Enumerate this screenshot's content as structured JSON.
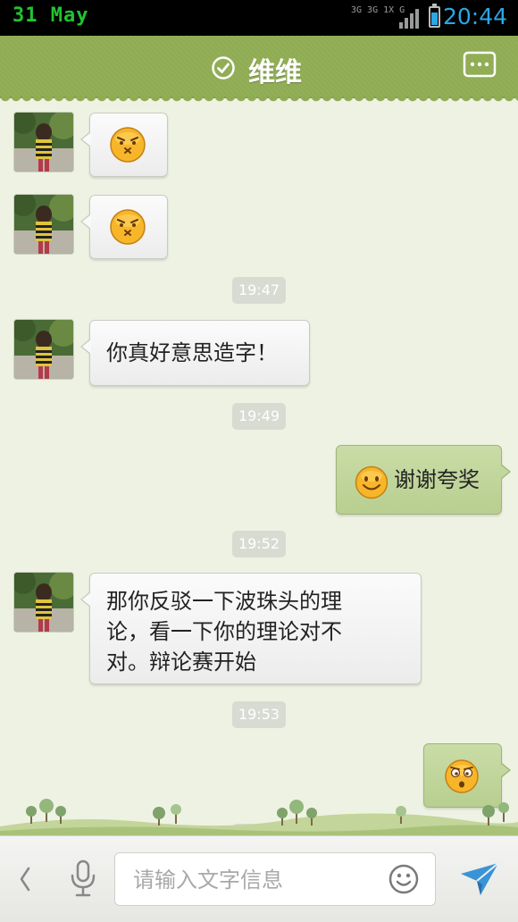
{
  "status_bar": {
    "date": "31 May",
    "network_label": "3G 3G 1X G",
    "time": "20:44",
    "battery_level": 0.6
  },
  "header": {
    "contact_name": "维维",
    "verified_icon": "check-circle-icon",
    "menu_icon": "chat-menu-icon"
  },
  "messages": [
    {
      "side": "left",
      "type": "emoji",
      "emoji": "grimace-emoji"
    },
    {
      "side": "left",
      "type": "emoji",
      "emoji": "grimace-emoji"
    },
    {
      "type": "time",
      "text": "19:47"
    },
    {
      "side": "left",
      "type": "text",
      "text": "你真好意思造字！"
    },
    {
      "type": "time",
      "text": "19:49"
    },
    {
      "side": "right",
      "type": "text",
      "emoji": "smile-emoji",
      "text": "谢谢夸奖"
    },
    {
      "type": "time",
      "text": "19:52"
    },
    {
      "side": "left",
      "type": "text",
      "text": "那你反驳一下波珠头的理论，看一下你的理论对不对。辩论赛开始"
    },
    {
      "type": "time",
      "text": "19:53"
    },
    {
      "side": "right",
      "type": "emoji",
      "emoji": "doubt-emoji"
    }
  ],
  "input_bar": {
    "placeholder": "请输入文字信息",
    "icons": [
      "back-icon",
      "microphone-icon",
      "emoji-icon",
      "send-icon"
    ]
  },
  "colors": {
    "header_green": "#8fac55",
    "outgoing_bubble": "#bfd597",
    "incoming_bubble": "#f4f4f4",
    "status_time_blue": "#2aa7e5",
    "chat_background": "#eef2e3"
  }
}
